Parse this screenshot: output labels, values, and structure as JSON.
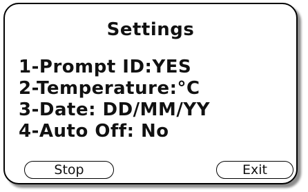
{
  "screen": {
    "title": "Settings",
    "menu_items": [
      "1-Prompt ID:YES",
      "2-Temperature:°C",
      "3-Date: DD/MM/YY",
      "4-Auto Off: No"
    ],
    "softkeys": {
      "left_label": "Stop",
      "right_label": "Exit"
    }
  }
}
